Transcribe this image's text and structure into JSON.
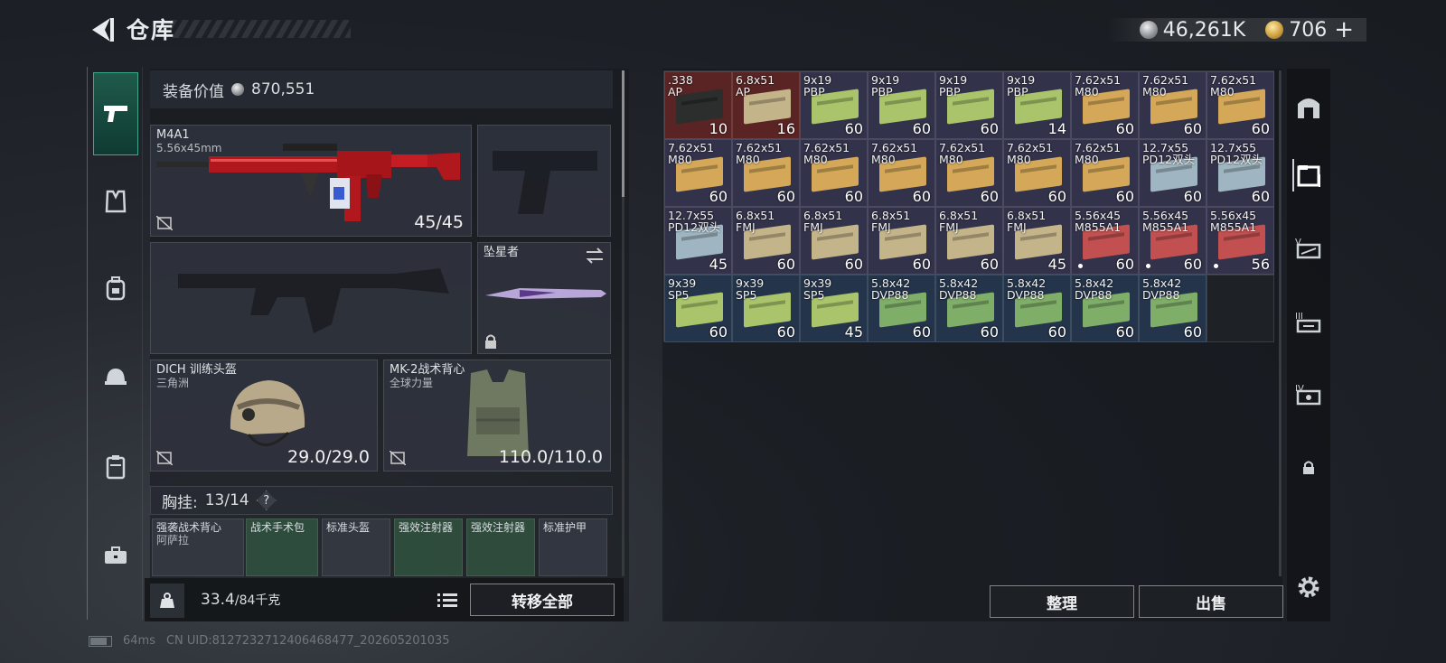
{
  "header": {
    "title": "仓库",
    "currency_silver": "46,261K",
    "currency_gold": "706"
  },
  "loadout": {
    "value_label": "装备价值",
    "value": "870,551",
    "primary": {
      "name": "M4A1",
      "caliber": "5.56x45mm",
      "ammo": "45/45"
    },
    "melee": {
      "name": "坠星者"
    },
    "helmet": {
      "name": "DICH 训练头盔",
      "faction": "三角洲",
      "durability": "29.0/29.0"
    },
    "armor": {
      "name": "MK-2战术背心",
      "faction": "全球力量",
      "durability": "110.0/110.0"
    },
    "chest_label": "胸挂:",
    "chest_value": "13/14",
    "chest_slots": [
      {
        "label": "强袭战术背心",
        "sub": "阿萨拉",
        "style": "dark"
      },
      {
        "label": "战术手术包",
        "sub": "",
        "style": "green"
      },
      {
        "label": "标准头盔",
        "sub": "",
        "style": "dark"
      },
      {
        "label": "强效注射器",
        "sub": "",
        "style": "green"
      },
      {
        "label": "强效注射器",
        "sub": "",
        "style": "green"
      },
      {
        "label": "标准护甲",
        "sub": "",
        "style": "dark"
      }
    ],
    "weight": "33.4",
    "weight_max": "/84千克",
    "transfer_all_label": "转移全部"
  },
  "storage": {
    "sort_label": "整理",
    "sell_label": "出售",
    "items": [
      {
        "l1": ".338",
        "l2": "AP",
        "count": "10",
        "bg": "#5a2424",
        "box": "#2b2e2c",
        "dot": false
      },
      {
        "l1": "6.8x51",
        "l2": "AP",
        "count": "16",
        "bg": "#5a2424",
        "box": "#c4b48a",
        "dot": false
      },
      {
        "l1": "9x19",
        "l2": "PBP",
        "count": "60",
        "bg": "#32324a",
        "box": "#a9c46a",
        "dot": false
      },
      {
        "l1": "9x19",
        "l2": "PBP",
        "count": "60",
        "bg": "#32324a",
        "box": "#a9c46a",
        "dot": false
      },
      {
        "l1": "9x19",
        "l2": "PBP",
        "count": "60",
        "bg": "#32324a",
        "box": "#a9c46a",
        "dot": false
      },
      {
        "l1": "9x19",
        "l2": "PBP",
        "count": "14",
        "bg": "#32324a",
        "box": "#a9c46a",
        "dot": false
      },
      {
        "l1": "7.62x51",
        "l2": "M80",
        "count": "60",
        "bg": "#32324a",
        "box": "#d4a858",
        "dot": false
      },
      {
        "l1": "7.62x51",
        "l2": "M80",
        "count": "60",
        "bg": "#32324a",
        "box": "#d4a858",
        "dot": false
      },
      {
        "l1": "7.62x51",
        "l2": "M80",
        "count": "60",
        "bg": "#32324a",
        "box": "#d4a858",
        "dot": false
      },
      {
        "l1": "7.62x51",
        "l2": "M80",
        "count": "60",
        "bg": "#32324a",
        "box": "#d4a858",
        "dot": false
      },
      {
        "l1": "7.62x51",
        "l2": "M80",
        "count": "60",
        "bg": "#32324a",
        "box": "#d4a858",
        "dot": false
      },
      {
        "l1": "7.62x51",
        "l2": "M80",
        "count": "60",
        "bg": "#32324a",
        "box": "#d4a858",
        "dot": false
      },
      {
        "l1": "7.62x51",
        "l2": "M80",
        "count": "60",
        "bg": "#32324a",
        "box": "#d4a858",
        "dot": false
      },
      {
        "l1": "7.62x51",
        "l2": "M80",
        "count": "60",
        "bg": "#32324a",
        "box": "#d4a858",
        "dot": false
      },
      {
        "l1": "7.62x51",
        "l2": "M80",
        "count": "60",
        "bg": "#32324a",
        "box": "#d4a858",
        "dot": false
      },
      {
        "l1": "7.62x51",
        "l2": "M80",
        "count": "60",
        "bg": "#32324a",
        "box": "#d4a858",
        "dot": false
      },
      {
        "l1": "12.7x55",
        "l2": "PD12双头",
        "count": "60",
        "bg": "#32324a",
        "box": "#9fb6c2",
        "dot": false
      },
      {
        "l1": "12.7x55",
        "l2": "PD12双头",
        "count": "60",
        "bg": "#32324a",
        "box": "#9fb6c2",
        "dot": false
      },
      {
        "l1": "12.7x55",
        "l2": "PD12双头",
        "count": "45",
        "bg": "#32324a",
        "box": "#9fb6c2",
        "dot": false
      },
      {
        "l1": "6.8x51",
        "l2": "FMJ",
        "count": "60",
        "bg": "#32324a",
        "box": "#c4b48a",
        "dot": false
      },
      {
        "l1": "6.8x51",
        "l2": "FMJ",
        "count": "60",
        "bg": "#32324a",
        "box": "#c4b48a",
        "dot": false
      },
      {
        "l1": "6.8x51",
        "l2": "FMJ",
        "count": "60",
        "bg": "#32324a",
        "box": "#c4b48a",
        "dot": false
      },
      {
        "l1": "6.8x51",
        "l2": "FMJ",
        "count": "60",
        "bg": "#32324a",
        "box": "#c4b48a",
        "dot": false
      },
      {
        "l1": "6.8x51",
        "l2": "FMJ",
        "count": "45",
        "bg": "#32324a",
        "box": "#c4b48a",
        "dot": false
      },
      {
        "l1": "5.56x45",
        "l2": "M855A1",
        "count": "60",
        "bg": "#32324a",
        "box": "#c25050",
        "dot": true
      },
      {
        "l1": "5.56x45",
        "l2": "M855A1",
        "count": "60",
        "bg": "#32324a",
        "box": "#c25050",
        "dot": true
      },
      {
        "l1": "5.56x45",
        "l2": "M855A1",
        "count": "56",
        "bg": "#32324a",
        "box": "#c25050",
        "dot": true
      },
      {
        "l1": "9x39",
        "l2": "SP5",
        "count": "60",
        "bg": "#24344a",
        "box": "#a9c46a",
        "dot": false
      },
      {
        "l1": "9x39",
        "l2": "SP5",
        "count": "60",
        "bg": "#24344a",
        "box": "#a9c46a",
        "dot": false
      },
      {
        "l1": "9x39",
        "l2": "SP5",
        "count": "45",
        "bg": "#24344a",
        "box": "#a9c46a",
        "dot": false
      },
      {
        "l1": "5.8x42",
        "l2": "DVP88",
        "count": "60",
        "bg": "#24344a",
        "box": "#7fae68",
        "dot": false
      },
      {
        "l1": "5.8x42",
        "l2": "DVP88",
        "count": "60",
        "bg": "#24344a",
        "box": "#7fae68",
        "dot": false
      },
      {
        "l1": "5.8x42",
        "l2": "DVP88",
        "count": "60",
        "bg": "#24344a",
        "box": "#7fae68",
        "dot": false
      },
      {
        "l1": "5.8x42",
        "l2": "DVP88",
        "count": "60",
        "bg": "#24344a",
        "box": "#7fae68",
        "dot": false
      },
      {
        "l1": "5.8x42",
        "l2": "DVP88",
        "count": "60",
        "bg": "#24344a",
        "box": "#7fae68",
        "dot": false
      }
    ]
  },
  "right_sidebar": {
    "tier3_label": "III",
    "tier4_label": "IV"
  },
  "status": {
    "ping": "64ms",
    "uid": "CN UID:8127232712406468477_202605201035"
  }
}
